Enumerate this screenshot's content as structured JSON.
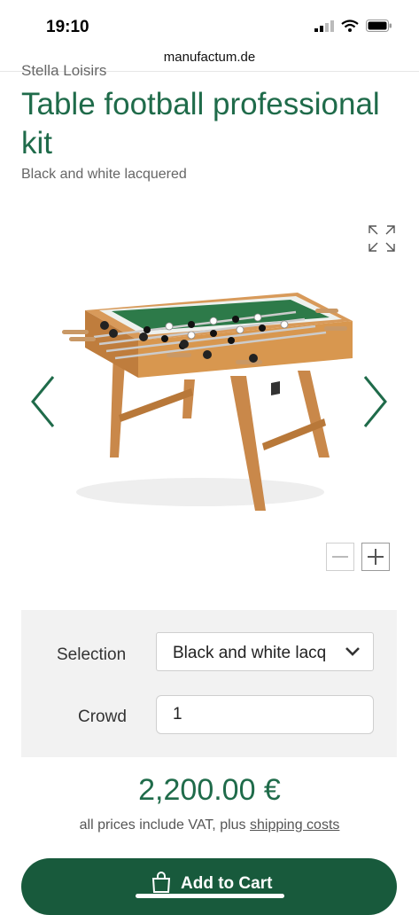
{
  "status_bar": {
    "time": "19:10"
  },
  "browser": {
    "url": "manufactum.de"
  },
  "product": {
    "brand": "Stella Loisirs",
    "title": "Table football professional kit",
    "subtitle": "Black and white lacquered"
  },
  "options": {
    "selection_label": "Selection",
    "selection_value": "Black and white lacq",
    "quantity_label": "Crowd",
    "quantity_value": "1"
  },
  "pricing": {
    "price": "2,200.00 €",
    "vat_prefix": "all prices include VAT, plus ",
    "shipping_link": "shipping costs"
  },
  "cart": {
    "button_label": "Add to Cart"
  },
  "colors": {
    "brand_green": "#1f6b4a",
    "button_green": "#185a3c",
    "panel_bg": "#f2f2f2"
  },
  "icons": [
    "signal-icon",
    "wifi-icon",
    "battery-icon",
    "expand-icon",
    "chevron-left-icon",
    "chevron-right-icon",
    "minus-icon",
    "plus-icon",
    "chevron-down-icon",
    "shopping-bag-icon"
  ]
}
